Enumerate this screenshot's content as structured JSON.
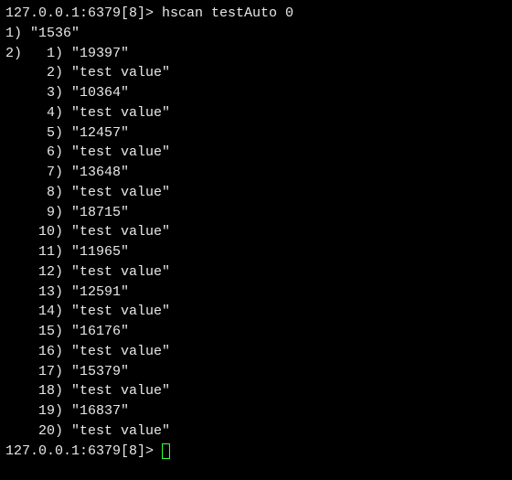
{
  "prompt": "127.0.0.1:6379[8]> ",
  "command": "hscan testAuto 0",
  "result": {
    "cursor": "1536",
    "items": [
      "19397",
      "test value",
      "10364",
      "test value",
      "12457",
      "test value",
      "13648",
      "test value",
      "18715",
      "test value",
      "11965",
      "test value",
      "12591",
      "test value",
      "16176",
      "test value",
      "15379",
      "test value",
      "16837",
      "test value"
    ]
  },
  "next_prompt": "127.0.0.1:6379[8]> "
}
